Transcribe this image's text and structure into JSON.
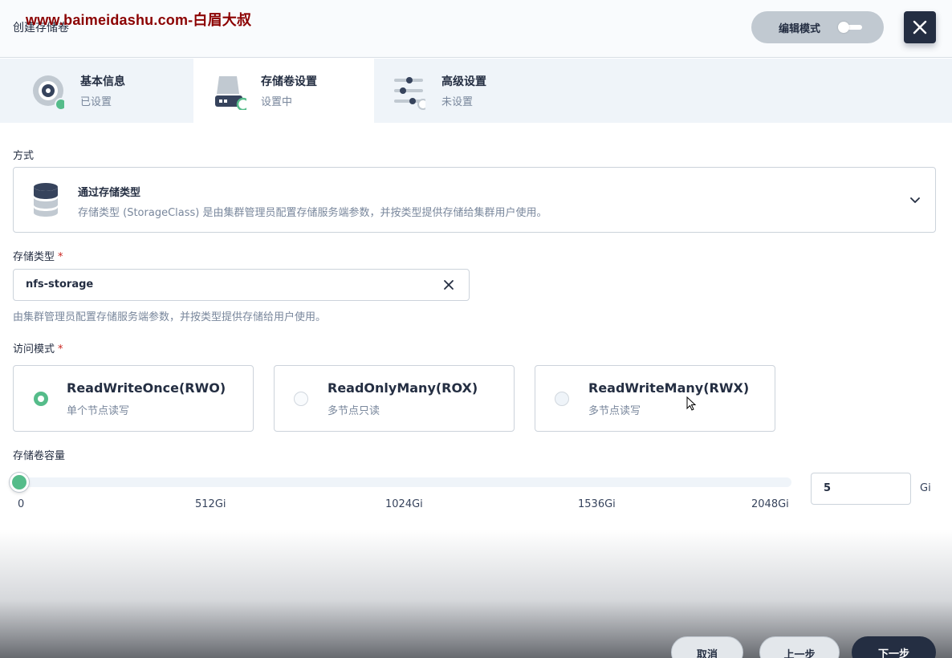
{
  "header": {
    "title": "创建存储卷",
    "watermark": "www.baimeidashu.com-白眉大叔",
    "edit_mode_label": "编辑模式",
    "close_icon": "close-icon"
  },
  "tabs": [
    {
      "label": "基本信息",
      "status": "已设置",
      "icon": "disk-icon",
      "state": "done"
    },
    {
      "label": "存储卷设置",
      "status": "设置中",
      "icon": "storage-drive-icon",
      "state": "active"
    },
    {
      "label": "高级设置",
      "status": "未设置",
      "icon": "sliders-icon",
      "state": "todo"
    }
  ],
  "method": {
    "label": "方式",
    "title": "通过存储类型",
    "description": "存储类型 (StorageClass) 是由集群管理员配置存储服务端参数，并按类型提供存储给集群用户使用。"
  },
  "storage_class": {
    "label": "存储类型",
    "required_mark": "*",
    "value": "nfs-storage",
    "hint": "由集群管理员配置存储服务端参数，并按类型提供存储给用户使用。"
  },
  "access_mode": {
    "label": "访问模式",
    "required_mark": "*",
    "options": [
      {
        "name": "ReadWriteOnce(RWO)",
        "desc": "单个节点读写",
        "selected": true
      },
      {
        "name": "ReadOnlyMany(ROX)",
        "desc": "多节点只读",
        "selected": false
      },
      {
        "name": "ReadWriteMany(RWX)",
        "desc": "多节点读写",
        "selected": false
      }
    ]
  },
  "capacity": {
    "label": "存储卷容量",
    "ticks": [
      "0",
      "512Gi",
      "1024Gi",
      "1536Gi",
      "2048Gi"
    ],
    "value": "5",
    "unit": "Gi",
    "min": 0,
    "max": 2048
  },
  "footer": {
    "cancel": "取消",
    "prev": "上一步",
    "next": "下一步"
  },
  "colors": {
    "accent_green": "#55bc8a",
    "dark": "#242e42",
    "required_red": "#ca2621"
  }
}
